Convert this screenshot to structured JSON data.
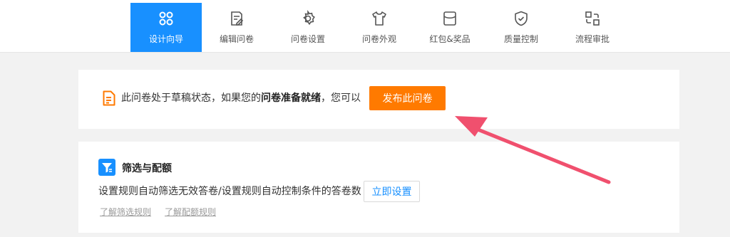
{
  "nav": {
    "tabs": [
      {
        "label": "设计向导",
        "icon": "grid-icon",
        "active": true
      },
      {
        "label": "编辑问卷",
        "icon": "edit-icon",
        "active": false
      },
      {
        "label": "问卷设置",
        "icon": "gear-icon",
        "active": false
      },
      {
        "label": "问卷外观",
        "icon": "shirt-icon",
        "active": false
      },
      {
        "label": "红包&奖品",
        "icon": "envelope-icon",
        "active": false
      },
      {
        "label": "质量控制",
        "icon": "shield-icon",
        "active": false
      },
      {
        "label": "流程审批",
        "icon": "flow-icon",
        "active": false
      }
    ]
  },
  "draft": {
    "text_before": "此问卷处于草稿状态，如果您的",
    "text_bold": "问卷准备就绪",
    "text_after": "，您可以",
    "publish_label": "发布此问卷"
  },
  "filter": {
    "title": "筛选与配额",
    "description": "设置规则自动筛选无效答卷/设置规则自动控制条件的答卷数",
    "setup_label": "立即设置",
    "link_filter": "了解筛选规则",
    "link_quota": "了解配额规则"
  },
  "colors": {
    "accent": "#1890ff",
    "publish": "#ff7a00",
    "annotation_arrow": "#f0506e"
  }
}
